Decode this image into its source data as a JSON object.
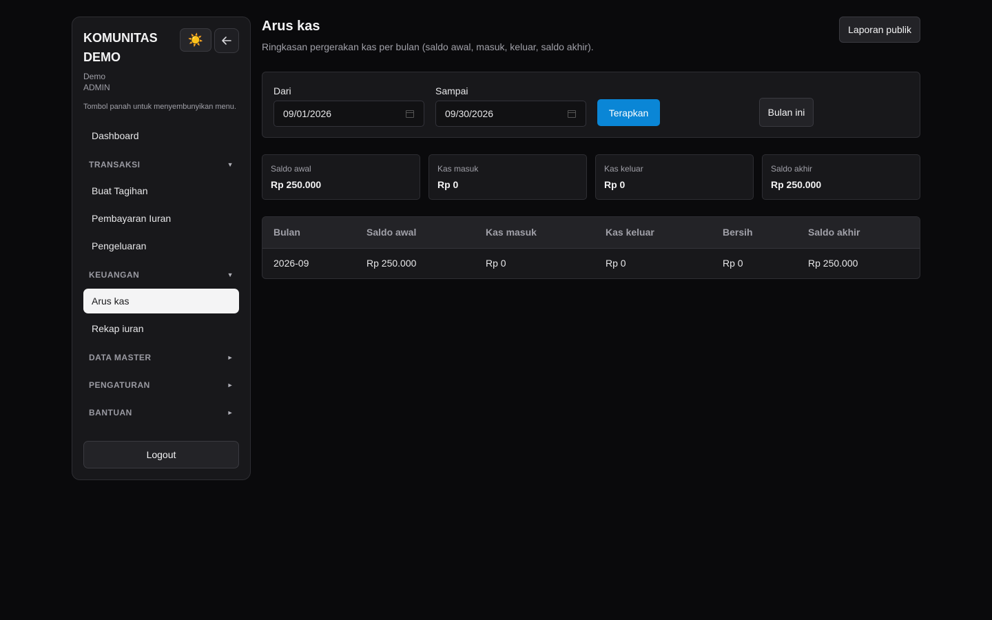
{
  "sidebar": {
    "brand": "KOMUNITAS DEMO",
    "user_name": "Demo",
    "user_role": "ADMIN",
    "hint": "Tombol panah untuk menyembunyikan menu.",
    "theme_icon": "☀️",
    "dashboard": "Dashboard",
    "groups": {
      "transaksi": "TRANSAKSI",
      "keuangan": "KEUANGAN",
      "data_master": "DATA MASTER",
      "pengaturan": "PENGATURAN",
      "bantuan": "BANTUAN"
    },
    "items": {
      "buat_tagihan": "Buat Tagihan",
      "pembayaran_iuran": "Pembayaran Iuran",
      "pengeluaran": "Pengeluaran",
      "arus_kas": "Arus kas",
      "rekap_iuran": "Rekap iuran"
    },
    "logout": "Logout"
  },
  "main": {
    "title": "Arus kas",
    "subtitle": "Ringkasan pergerakan kas per bulan (saldo awal, masuk, keluar, saldo akhir).",
    "report_button": "Laporan publik"
  },
  "filter": {
    "from_label": "Dari",
    "from_value": "09/01/2026",
    "to_label": "Sampai",
    "to_value": "09/30/2026",
    "apply": "Terapkan",
    "this_month": "Bulan ini"
  },
  "stats": [
    {
      "label": "Saldo awal",
      "value": "Rp 250.000"
    },
    {
      "label": "Kas masuk",
      "value": "Rp 0"
    },
    {
      "label": "Kas keluar",
      "value": "Rp 0"
    },
    {
      "label": "Saldo akhir",
      "value": "Rp 250.000"
    }
  ],
  "table": {
    "headers": [
      "Bulan",
      "Saldo awal",
      "Kas masuk",
      "Kas keluar",
      "Bersih",
      "Saldo akhir"
    ],
    "rows": [
      [
        "2026-09",
        "Rp 250.000",
        "Rp 0",
        "Rp 0",
        "Rp 0",
        "Rp 250.000"
      ]
    ]
  },
  "colors": {
    "background": "#0a0a0c",
    "panel": "#18181b",
    "accent": "#0a86d6",
    "active_nav": "#f4f4f5"
  }
}
